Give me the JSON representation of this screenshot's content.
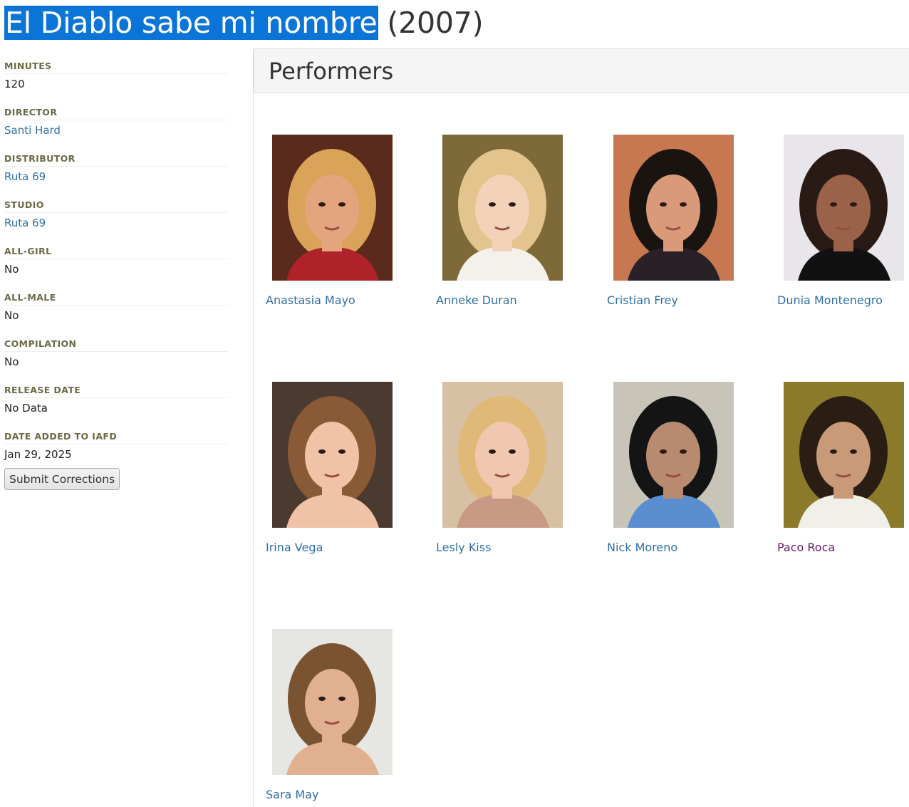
{
  "page": {
    "title_highlighted": "El Diablo sabe mi nombre",
    "title_year": "(2007)"
  },
  "sidebar": {
    "fields": [
      {
        "label": "MINUTES",
        "value": "120"
      },
      {
        "label": "DIRECTOR",
        "value": "Santi Hard"
      },
      {
        "label": "DISTRIBUTOR",
        "value": "Ruta 69"
      },
      {
        "label": "STUDIO",
        "value": "Ruta 69"
      },
      {
        "label": "ALL-GIRL",
        "value": "No"
      },
      {
        "label": "ALL-MALE",
        "value": "No"
      },
      {
        "label": "COMPILATION",
        "value": "No"
      },
      {
        "label": "RELEASE DATE",
        "value": "No Data"
      },
      {
        "label": "DATE ADDED TO IAFD",
        "value": "Jan 29, 2025"
      }
    ],
    "submit_label": "Submit Corrections"
  },
  "performers": {
    "heading": "Performers",
    "items": [
      {
        "name": "Anastasia Mayo",
        "visited": false,
        "bg": "#5a2a1c",
        "hair": "#d9a45a",
        "skin": "#e2a57e",
        "shirt": "#b0222a"
      },
      {
        "name": "Anneke Duran",
        "visited": false,
        "bg": "#7e6a38",
        "hair": "#e2c48c",
        "skin": "#f2d2b8",
        "shirt": "#f4f0ec"
      },
      {
        "name": "Cristian Frey",
        "visited": false,
        "bg": "#c87850",
        "hair": "#1a1410",
        "skin": "#d89a78",
        "shirt": "#2a2028"
      },
      {
        "name": "Dunia Montenegro",
        "visited": false,
        "bg": "#e8e6ea",
        "hair": "#2a1a16",
        "skin": "#9a6248",
        "shirt": "#111111"
      },
      {
        "name": "Irina Vega",
        "visited": false,
        "bg": "#4a3a30",
        "hair": "#8a5a36",
        "skin": "#f0c2a6",
        "shirt": "#f0c2a6"
      },
      {
        "name": "Lesly Kiss",
        "visited": false,
        "bg": "#d8c0a4",
        "hair": "#e0b878",
        "skin": "#f0c8b0",
        "shirt": "#c89a86"
      },
      {
        "name": "Nick Moreno",
        "visited": false,
        "bg": "#c8c4b8",
        "hair": "#141414",
        "skin": "#b88a70",
        "shirt": "#5a8ed0"
      },
      {
        "name": "Paco Roca",
        "visited": true,
        "bg": "#8a7a2a",
        "hair": "#2a1e14",
        "skin": "#c89a78",
        "shirt": "#f0f0e8"
      },
      {
        "name": "Sara May",
        "visited": false,
        "bg": "#e6e6e2",
        "hair": "#7a5430",
        "skin": "#e0b090",
        "shirt": "#e0b090"
      }
    ]
  }
}
